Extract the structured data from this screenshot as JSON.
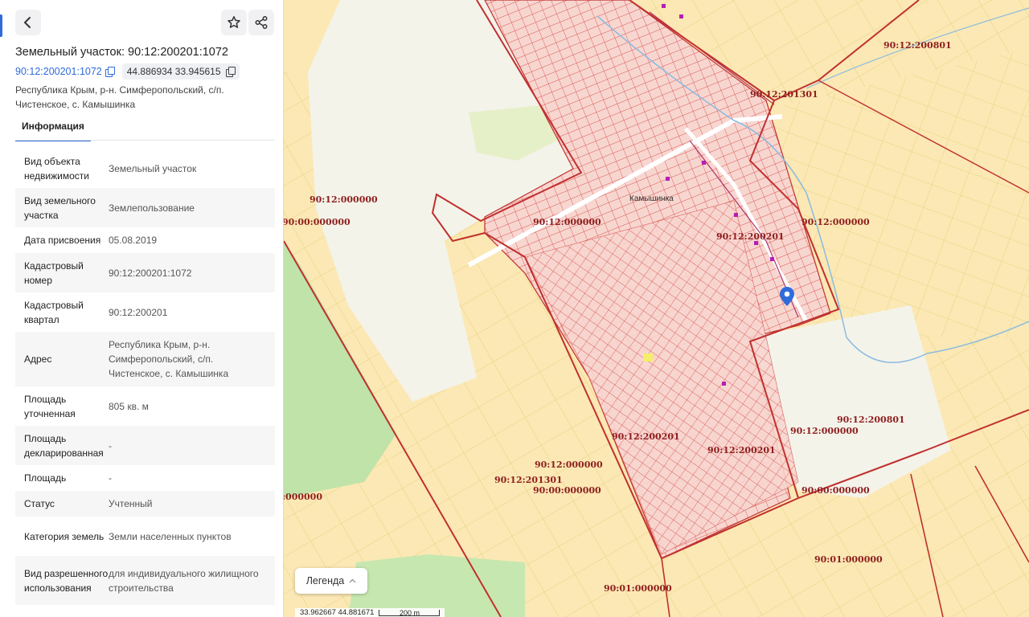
{
  "panel": {
    "title": "Земельный участок: 90:12:200201:1072",
    "cadastral_link": "90:12:200201:1072",
    "coords": "44.886934 33.945615",
    "address": "Республика Крым, р-н. Симферопольский, с/п. Чистенское, с. Камышинка",
    "tab_info": "Информация",
    "rows": [
      {
        "key": "Вид объекта недвижимости",
        "value": "Земельный участок"
      },
      {
        "key": "Вид земельного участка",
        "value": "Землепользование"
      },
      {
        "key": "Дата присвоения",
        "value": "05.08.2019"
      },
      {
        "key": "Кадастровый номер",
        "value": "90:12:200201:1072"
      },
      {
        "key": "Кадастровый квартал",
        "value": "90:12:200201"
      },
      {
        "key": "Адрес",
        "value": "Республика Крым, р-н. Симферопольский, с/п. Чистенское, с. Камышинка"
      },
      {
        "key": "Площадь уточненная",
        "value": "805 кв. м"
      },
      {
        "key": "Площадь декларированная",
        "value": "-"
      },
      {
        "key": "Площадь",
        "value": "-"
      },
      {
        "key": "Статус",
        "value": "Учтенный"
      },
      {
        "key": "Категория земель",
        "value": "Земли населенных пунктов"
      },
      {
        "key": "Вид разрешенного использования",
        "value": "для индивидуального жилищного строительства"
      }
    ]
  },
  "map": {
    "labels": [
      "90:12:200801",
      "90:12:201301",
      "90:12:000000",
      "90:00:000000",
      "90:12:000000",
      "90:12:200201",
      "90:12:000000",
      "90:12:200801",
      "90:12:000000",
      "90:12:200201",
      "90:12:200201",
      "90:12:000000",
      "90:12:201301",
      "90:00:000000",
      "90:00:000000",
      ":000000",
      "90:01:000000",
      "90:01:000000"
    ],
    "place_name": "Камышинка",
    "legend_label": "Легенда",
    "scale_coords": "33.962667  44.881671",
    "scale_distance": "200 m",
    "colors": {
      "parcel_fill": "#fbe7b8",
      "parcel_line": "#e2c860",
      "boundary": "#c0302f",
      "settlement_fill": "#f7c9c4",
      "road": "#ffffff",
      "river": "#8bbbe0",
      "accent": "#2f6bdb"
    }
  }
}
